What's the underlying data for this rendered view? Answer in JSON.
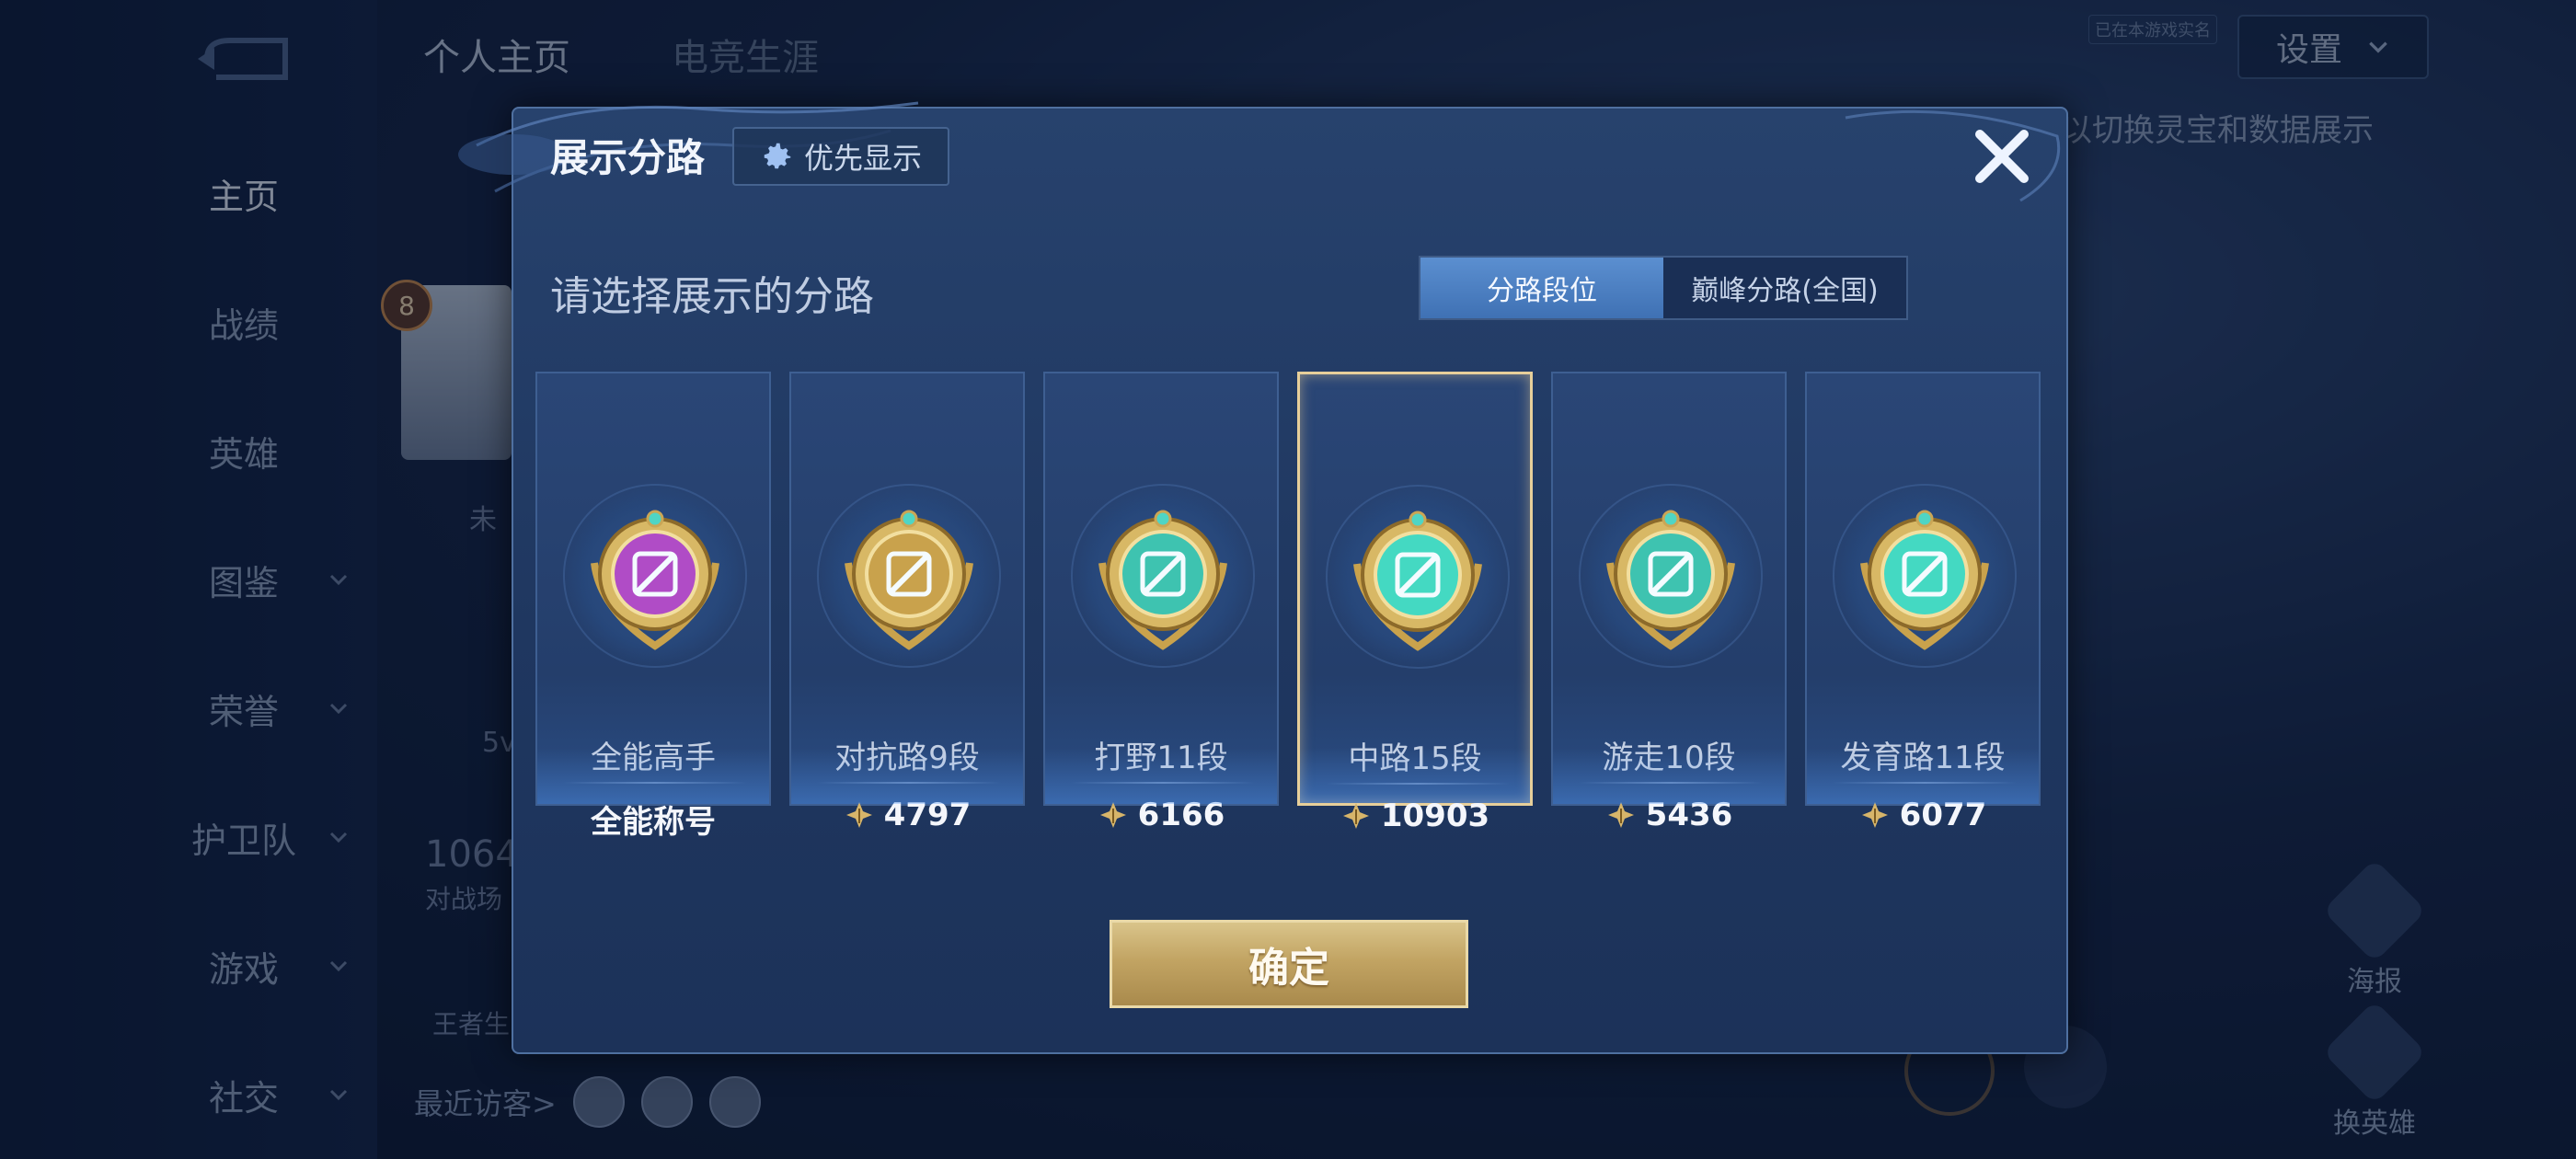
{
  "nav": {
    "items": [
      {
        "label": "主页"
      },
      {
        "label": "战绩"
      },
      {
        "label": "英雄"
      },
      {
        "label": "图鉴"
      },
      {
        "label": "荣誉"
      },
      {
        "label": "护卫队"
      },
      {
        "label": "游戏"
      },
      {
        "label": "社交"
      }
    ]
  },
  "top_tabs": {
    "personal": "个人主页",
    "esports": "电竞生涯"
  },
  "settings": {
    "label": "设置",
    "tag": "已在本游戏实名"
  },
  "background": {
    "hint": "以切换灵宝和数据展示",
    "level": "8",
    "text_a": "未",
    "text_b": "5v",
    "text_c": "1064",
    "text_d": "对战场",
    "text_e": "王者生",
    "visitors_label": "最近访客>",
    "poster_label": "海报",
    "swap_hero_label": "换英雄"
  },
  "dialog": {
    "title": "展示分路",
    "priority_label": "优先显示",
    "subtitle": "请选择展示的分路",
    "tabs": [
      {
        "label": "分路段位"
      },
      {
        "label": "巅峰分路(全国)"
      }
    ],
    "cards": [
      {
        "rank": "全能高手",
        "score": "全能称号",
        "score_icon": false,
        "emblem": "all-round-emblem",
        "gem": "#b04cc6"
      },
      {
        "rank": "对抗路9段",
        "score": "4797",
        "score_icon": true,
        "emblem": "clash-lane-emblem",
        "gem": "#c9a24c"
      },
      {
        "rank": "打野11段",
        "score": "6166",
        "score_icon": true,
        "emblem": "jungle-emblem",
        "gem": "#3ec3b0"
      },
      {
        "rank": "中路15段",
        "score": "10903",
        "score_icon": true,
        "emblem": "mid-lane-emblem",
        "gem": "#44d9c2"
      },
      {
        "rank": "游走10段",
        "score": "5436",
        "score_icon": true,
        "emblem": "roam-emblem",
        "gem": "#3ec3b0"
      },
      {
        "rank": "发育路11段",
        "score": "6077",
        "score_icon": true,
        "emblem": "farm-lane-emblem",
        "gem": "#44d9c2"
      }
    ],
    "selected_card": "中路15段",
    "confirm_label": "确定"
  },
  "colors": {
    "accent_gold": "#e7cf9a",
    "tab_active": "#4a7fc2",
    "panel": "#22395f"
  }
}
